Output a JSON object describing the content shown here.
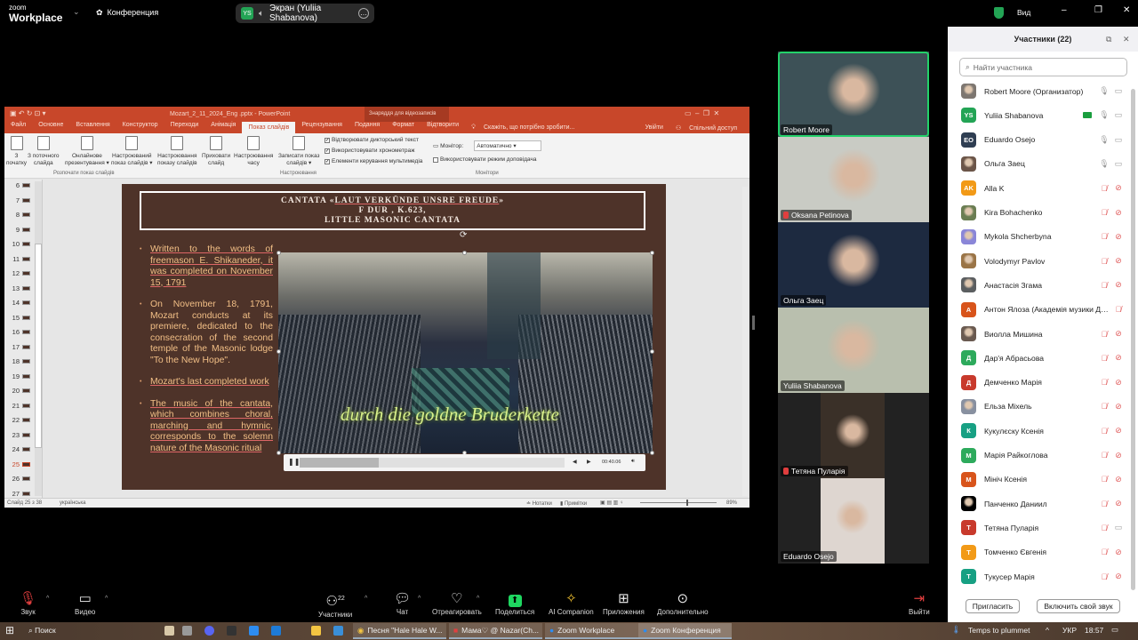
{
  "topbar": {
    "logo_small": "zoom",
    "logo_big": "Workplace",
    "meeting_label": "Конференция",
    "share_initials": "YS",
    "share_label": "Экран (Yuliia Shabanova)",
    "view_label": "Вид"
  },
  "ppt": {
    "title": "Mozart_2_11_2024_Eng .pptx - PowerPoint",
    "context_tab_group": "Знаряддя для відеозаписів",
    "tabs": [
      "Файл",
      "Основне",
      "Вставлення",
      "Конструктор",
      "Переходи",
      "Анімація",
      "Показ слайдів",
      "Рецензування",
      "Подання",
      "Формат",
      "Відтворити"
    ],
    "active_tab": "Показ слайдів",
    "tell_me": "Скажіть, що потрібно зробити...",
    "sign_in": "Увійти",
    "share": "Спільний доступ",
    "ribbon_buttons": [
      [
        "З",
        "початку"
      ],
      [
        "З поточного",
        "слайда"
      ],
      [
        "Онлайнове",
        "презентування ▾"
      ],
      [
        "Настроюваний",
        "показ слайдів ▾"
      ],
      [
        "Настроювання",
        "показу слайдів"
      ],
      [
        "Приховати",
        "слайд"
      ],
      [
        "Настроювання",
        "часу"
      ],
      [
        "Записати показ",
        "слайдів ▾"
      ]
    ],
    "checkboxes": [
      "Відтворювати дикторський текст",
      "Використовувати хронометраж",
      "Елементи керування мультимедіа"
    ],
    "monitor_label": "Монітор:",
    "monitor_value": "Автоматично",
    "presenter_view": "Використовувати режим доповідача",
    "groups": [
      "Розпочати показ слайдів",
      "Настроювання",
      "Монітори"
    ],
    "thumb_numbers": [
      "6",
      "7",
      "8",
      "9",
      "10",
      "11",
      "12",
      "13",
      "14",
      "15",
      "16",
      "17",
      "18",
      "19",
      "20",
      "21",
      "22",
      "23",
      "24",
      "25",
      "26",
      "27"
    ],
    "current_slide": "25",
    "status_left": "Слайд 25 з 38",
    "status_lang": "українська",
    "notes": "Нотатки",
    "comments": "Примітки",
    "zoom": "89%"
  },
  "slide": {
    "title_l1_pre": "CANTATA «",
    "title_l1_u": "LAUT VERKÜNDE UNSRE FREUDE",
    "title_l1_post": "»",
    "title_l2": "F DUR , K.623,",
    "title_l3": "LITTLE MASONIC CANTATA",
    "bullets": [
      "Written to the words of freemason E. Shikaneder, it was completed on November 15, 1791",
      "On November 18, 1791, Mozart conducts at its premiere, dedicated to the consecration of the second temple of the Masonic lodge \"To the New Hope\".",
      "Mozart's last completed work",
      "The music of the cantata, which combines choral, marching and hymnic, corresponds to the solemn nature of the Masonic ritual"
    ],
    "video_caption": "durch die goldne Bruderkette",
    "video_time": "00:40.06",
    "video_progress": 0.3
  },
  "gallery": [
    {
      "name": "Robert Moore",
      "muted": false,
      "active": true,
      "bg": "#3d5157"
    },
    {
      "name": "Oksana Petinova",
      "muted": true,
      "active": false,
      "bg": "#c9cbc4"
    },
    {
      "name": "Ольга Заец",
      "muted": false,
      "active": false,
      "bg": "#1d2a40"
    },
    {
      "name": "Yuliia Shabanova",
      "muted": false,
      "active": false,
      "bg": "#b9bfae"
    },
    {
      "name": "Тетяна Пуларія",
      "muted": true,
      "active": false,
      "bg": "#3a3028"
    },
    {
      "name": "Eduardo Osejo",
      "muted": false,
      "active": false,
      "bg": "#ded6d0"
    }
  ],
  "panel": {
    "title": "Участники (22)",
    "search_placeholder": "Найти участника",
    "invite": "Пригласить",
    "unmute_self": "Включить свой звук",
    "participants": [
      {
        "name": "Robert Moore (Организатор)",
        "avatar": "",
        "color": "#7d7670",
        "mic": "on",
        "cam": "on"
      },
      {
        "name": "Yuliia Shabanova",
        "avatar": "YS",
        "color": "#23a455",
        "mic": "on",
        "cam": "on",
        "sharing": true
      },
      {
        "name": "Eduardo Osejo",
        "avatar": "EO",
        "color": "#2f3e52",
        "mic": "on",
        "cam": "on"
      },
      {
        "name": "Ольга Заец",
        "avatar": "",
        "color": "#6b5548",
        "mic": "on",
        "cam": "on"
      },
      {
        "name": "Alla K",
        "avatar": "AK",
        "color": "#f29a17",
        "mic": "off",
        "cam": "off"
      },
      {
        "name": "Kira Bohachenko",
        "avatar": "",
        "color": "#6a7d52",
        "mic": "off",
        "cam": "off"
      },
      {
        "name": "Mykola Shcherbyna",
        "avatar": "",
        "color": "#8a86d8",
        "mic": "off",
        "cam": "off"
      },
      {
        "name": "Volodymyr Pavlov",
        "avatar": "",
        "color": "#9a7446",
        "mic": "off",
        "cam": "off"
      },
      {
        "name": "Анастасія Згама",
        "avatar": "",
        "color": "#5b5e60",
        "mic": "off",
        "cam": "off"
      },
      {
        "name": "Антон Ялоза (Академія музики ДА...",
        "avatar": "А",
        "color": "#d8541b",
        "mic": "off",
        "cam": "none"
      },
      {
        "name": "Виолла Мишина",
        "avatar": "",
        "color": "#6a5a50",
        "mic": "off",
        "cam": "off"
      },
      {
        "name": "Дар'я Абрасьова",
        "avatar": "Д",
        "color": "#2daa5c",
        "mic": "off",
        "cam": "off"
      },
      {
        "name": "Демченко Марія",
        "avatar": "Д",
        "color": "#c83a2c",
        "mic": "off",
        "cam": "off"
      },
      {
        "name": "Ельза Міхель",
        "avatar": "",
        "color": "#8890a0",
        "mic": "off",
        "cam": "off"
      },
      {
        "name": "Кукулєску Ксенія",
        "avatar": "К",
        "color": "#17a083",
        "mic": "off",
        "cam": "off"
      },
      {
        "name": "Марія Райкоглова",
        "avatar": "М",
        "color": "#2daa5c",
        "mic": "off",
        "cam": "off"
      },
      {
        "name": "Мініч Ксенія",
        "avatar": "М",
        "color": "#d8541b",
        "mic": "off",
        "cam": "off"
      },
      {
        "name": "Панченко Даниил",
        "avatar": "",
        "color": "#000000",
        "mic": "off",
        "cam": "off"
      },
      {
        "name": "Тетяна Пуларія",
        "avatar": "Т",
        "color": "#c83a2c",
        "mic": "off",
        "cam": "on"
      },
      {
        "name": "Томченко Євгенія",
        "avatar": "Т",
        "color": "#f29a17",
        "mic": "off",
        "cam": "off"
      },
      {
        "name": "Тукусер Марія",
        "avatar": "Т",
        "color": "#17a083",
        "mic": "off",
        "cam": "off"
      }
    ]
  },
  "toolbar": {
    "audio": "Звук",
    "video": "Видео",
    "participants": "Участники",
    "participants_count": "22",
    "chat": "Чат",
    "react": "Отреагировать",
    "share": "Поделиться",
    "ai": "AI Companion",
    "apps": "Приложения",
    "more": "Дополнительно",
    "leave": "Выйти"
  },
  "taskbar": {
    "search": "Поиск",
    "tasks": [
      "Песня \"Hale Hale W...",
      "Мама♡ @ Nazar(Ch...",
      "Zoom Workplace",
      "Zoom Конференция"
    ],
    "weather": "Temps to plummet",
    "lang": "УКР",
    "time": "18:57"
  },
  "colors": {
    "ppt_accent": "#c8472a",
    "slide_bg": "#4e3329",
    "bullet_text": "#f2bf86",
    "zoom_green": "#23a455",
    "muted_red": "#e05a5a"
  }
}
